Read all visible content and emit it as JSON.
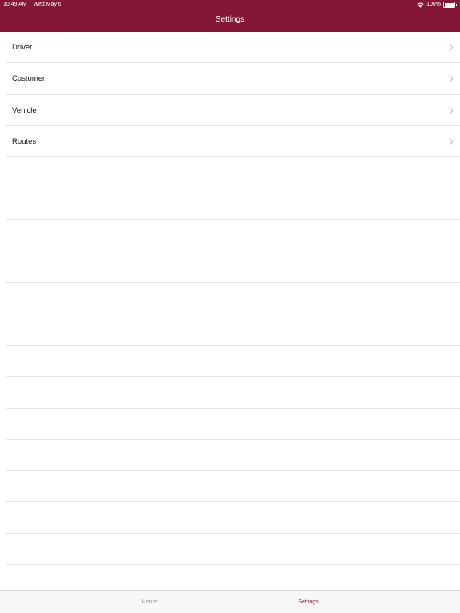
{
  "status_bar": {
    "time": "10:49 AM",
    "date": "Wed May 6",
    "battery_text": "100%"
  },
  "nav": {
    "title": "Settings"
  },
  "settings_items": [
    {
      "label": "Driver"
    },
    {
      "label": "Customer"
    },
    {
      "label": "Vehicle"
    },
    {
      "label": "Routes"
    }
  ],
  "empty_rows": 14,
  "tabbar": {
    "home_label": "Home",
    "settings_label": "Settings",
    "active_tab": "Settings"
  },
  "colors": {
    "brand": "#851736",
    "separator": "#e4e4e7",
    "chevron": "#c4c4c7",
    "tab_inactive": "#9a9a9a"
  },
  "icons": {
    "wifi": "wifi-icon",
    "battery": "battery-icon",
    "disclosure": "chevron-right-icon"
  }
}
